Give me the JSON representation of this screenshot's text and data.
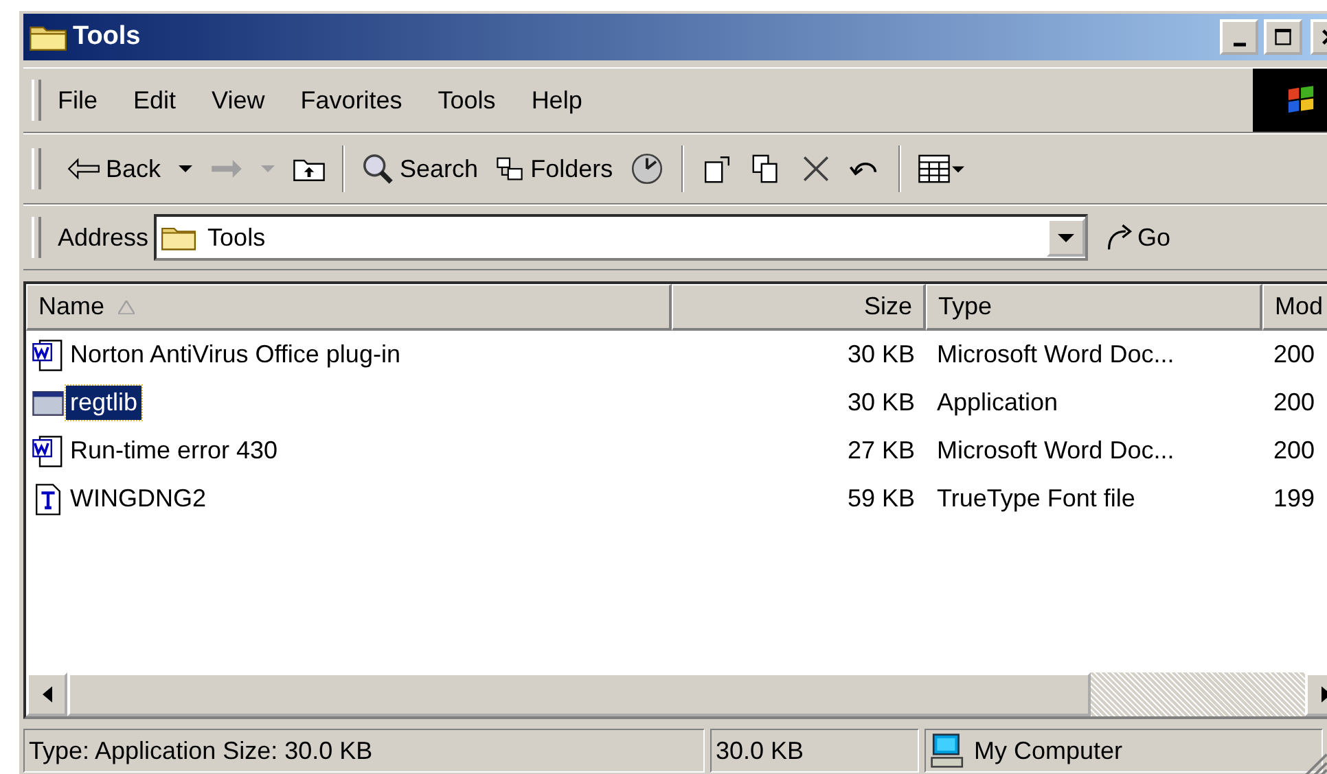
{
  "window": {
    "title": "Tools"
  },
  "menu": [
    "File",
    "Edit",
    "View",
    "Favorites",
    "Tools",
    "Help"
  ],
  "toolbar": {
    "back": {
      "label": "Back",
      "disabled": false
    },
    "forward": {
      "disabled": true
    },
    "search": {
      "label": "Search"
    },
    "folders": {
      "label": "Folders"
    }
  },
  "address": {
    "label": "Address",
    "value": "Tools",
    "go_label": "Go"
  },
  "table": {
    "columns": [
      "Name",
      "Size",
      "Type",
      "Mod"
    ],
    "rows": [
      {
        "kind": "word",
        "name": "Norton AntiVirus Office plug-in",
        "size": "30 KB",
        "type": "Microsoft Word Doc...",
        "modified": "200",
        "selected": false
      },
      {
        "kind": "app",
        "name": "regtlib",
        "size": "30 KB",
        "type": "Application",
        "modified": "200",
        "selected": true
      },
      {
        "kind": "word",
        "name": "Run-time error 430",
        "size": "27 KB",
        "type": "Microsoft Word Doc...",
        "modified": "200",
        "selected": false
      },
      {
        "kind": "font",
        "name": "WINGDNG2",
        "size": "59 KB",
        "type": "TrueType Font file",
        "modified": "199",
        "selected": false
      }
    ]
  },
  "status_bar": [
    "Type: Application Size: 30.0 KB",
    "30.0 KB",
    "My Computer"
  ]
}
